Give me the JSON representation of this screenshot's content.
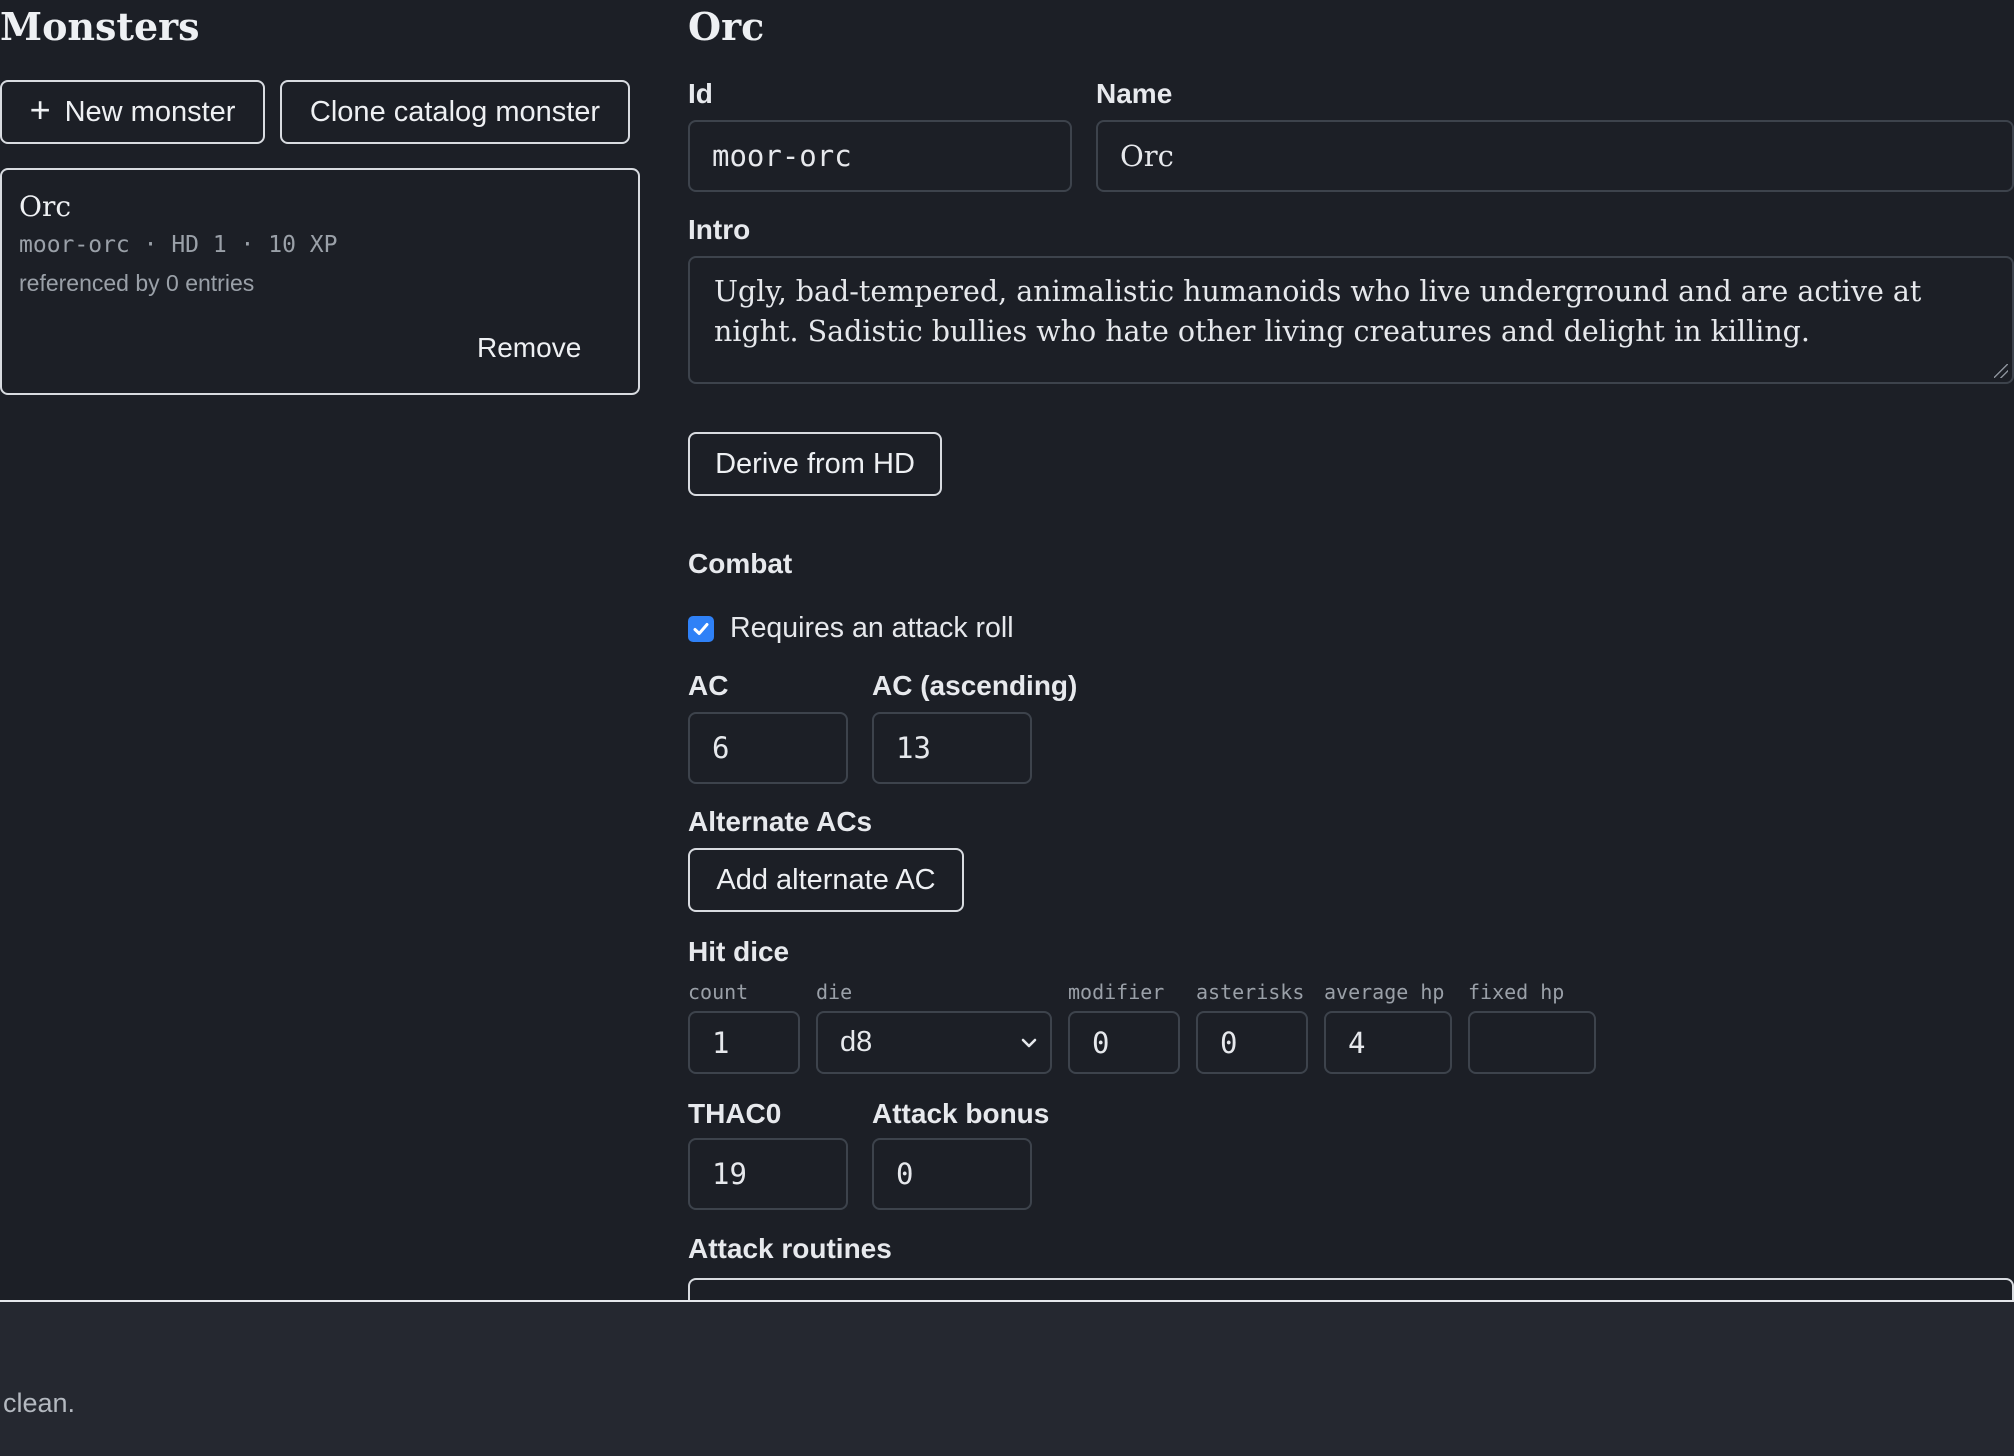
{
  "sidebar": {
    "title": "Monsters",
    "new_monster_label": "New monster",
    "clone_label": "Clone catalog monster",
    "card": {
      "name": "Orc",
      "meta": "moor-orc · HD 1 · 10 XP",
      "references": "referenced by 0 entries",
      "remove_label": "Remove"
    }
  },
  "editor": {
    "title": "Orc",
    "id_label": "Id",
    "id_value": "moor-orc",
    "name_label": "Name",
    "name_value": "Orc",
    "intro_label": "Intro",
    "intro_value": "Ugly, bad-tempered, animalistic humanoids who live underground and are active at night. Sadistic bullies who hate other living creatures and delight in killing.",
    "derive_label": "Derive from HD",
    "combat_heading": "Combat",
    "attack_roll_label": "Requires an attack roll",
    "attack_roll_checked": true,
    "ac_label": "AC",
    "ac_value": "6",
    "ac_asc_label": "AC (ascending)",
    "ac_asc_value": "13",
    "alt_acs_label": "Alternate ACs",
    "add_alt_ac_label": "Add alternate AC",
    "hit_dice_label": "Hit dice",
    "hd": {
      "count_label": "count",
      "count_value": "1",
      "die_label": "die",
      "die_value": "d8",
      "modifier_label": "modifier",
      "modifier_value": "0",
      "asterisks_label": "asterisks",
      "asterisks_value": "0",
      "avg_label": "average hp",
      "avg_value": "4",
      "fixed_label": "fixed hp",
      "fixed_value": ""
    },
    "thac0_label": "THAC0",
    "thac0_value": "19",
    "attack_bonus_label": "Attack bonus",
    "attack_bonus_value": "0",
    "attack_routines_label": "Attack routines"
  },
  "footer": {
    "status": "clean."
  },
  "icons": {
    "plus": "plus-icon",
    "check": "check-icon",
    "chevron": "chevron-down-icon"
  },
  "colors": {
    "background": "#1c1f26",
    "footer": "#252830",
    "accent": "#2f81f7"
  }
}
